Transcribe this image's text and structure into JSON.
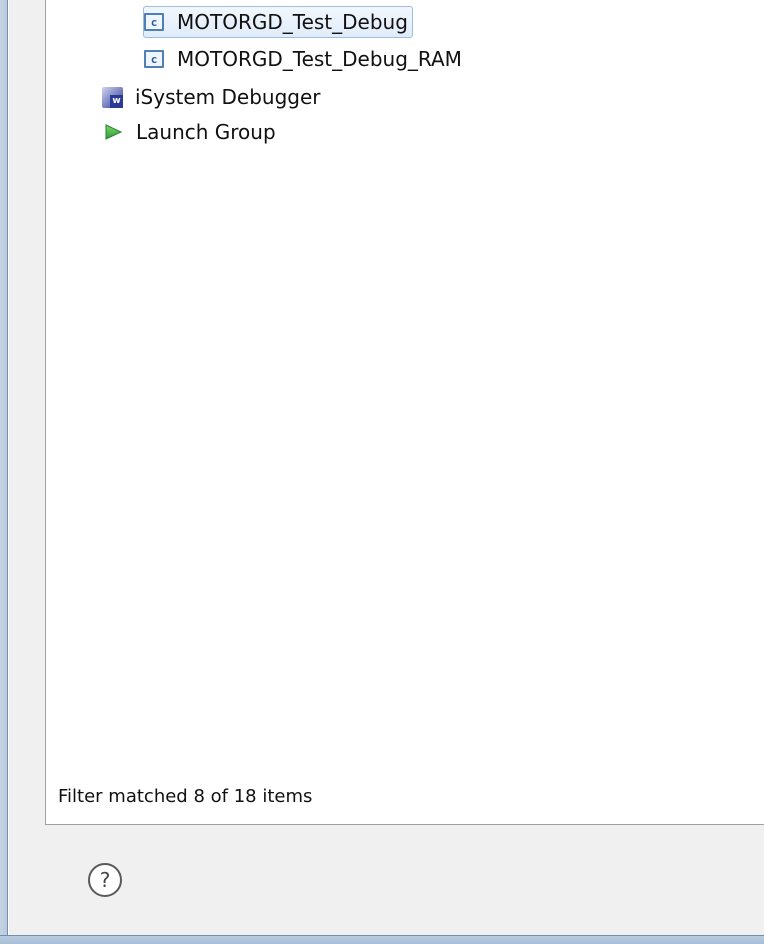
{
  "tree": {
    "items": [
      {
        "label": "MOTORGD_Test_Debug",
        "icon": "c-config-icon",
        "selected": true
      },
      {
        "label": "MOTORGD_Test_Debug_RAM",
        "icon": "c-config-icon",
        "selected": false
      },
      {
        "label": "iSystem Debugger",
        "icon": "isystem-debugger-icon",
        "selected": false
      },
      {
        "label": "Launch Group",
        "icon": "launch-group-icon",
        "selected": false
      }
    ]
  },
  "status": {
    "filter_text": "Filter matched 8 of 18 items"
  },
  "footer": {
    "help_icon": "help-icon"
  },
  "colors": {
    "selection_border": "#9ebde0",
    "c_icon_blue": "#4f7fb8",
    "launch_green": "#3fae3f"
  }
}
